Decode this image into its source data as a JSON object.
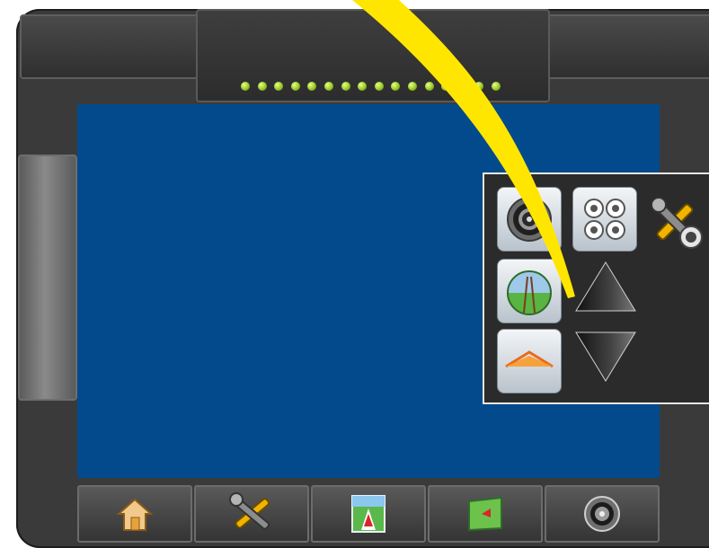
{
  "lightbar": {
    "led_count": 16,
    "led_color": "#8fc31f"
  },
  "map": {
    "background_color": "#034a8d"
  },
  "popup": {
    "tiles": [
      {
        "icon": "camera-lens-icon"
      },
      {
        "icon": "multi-camera-icon"
      },
      {
        "icon": "tools-settings-icon"
      },
      {
        "icon": "vehicle-view-icon"
      },
      {
        "icon": "arrow-up-icon"
      },
      {
        "icon": "horizon-view-icon"
      },
      {
        "icon": "arrow-down-icon"
      }
    ]
  },
  "bottom_nav": [
    {
      "icon": "home-icon"
    },
    {
      "icon": "tools-icon"
    },
    {
      "icon": "guidance-icon"
    },
    {
      "icon": "field-map-icon"
    },
    {
      "icon": "camera-icon"
    }
  ],
  "highlight_color": "#ffe600"
}
